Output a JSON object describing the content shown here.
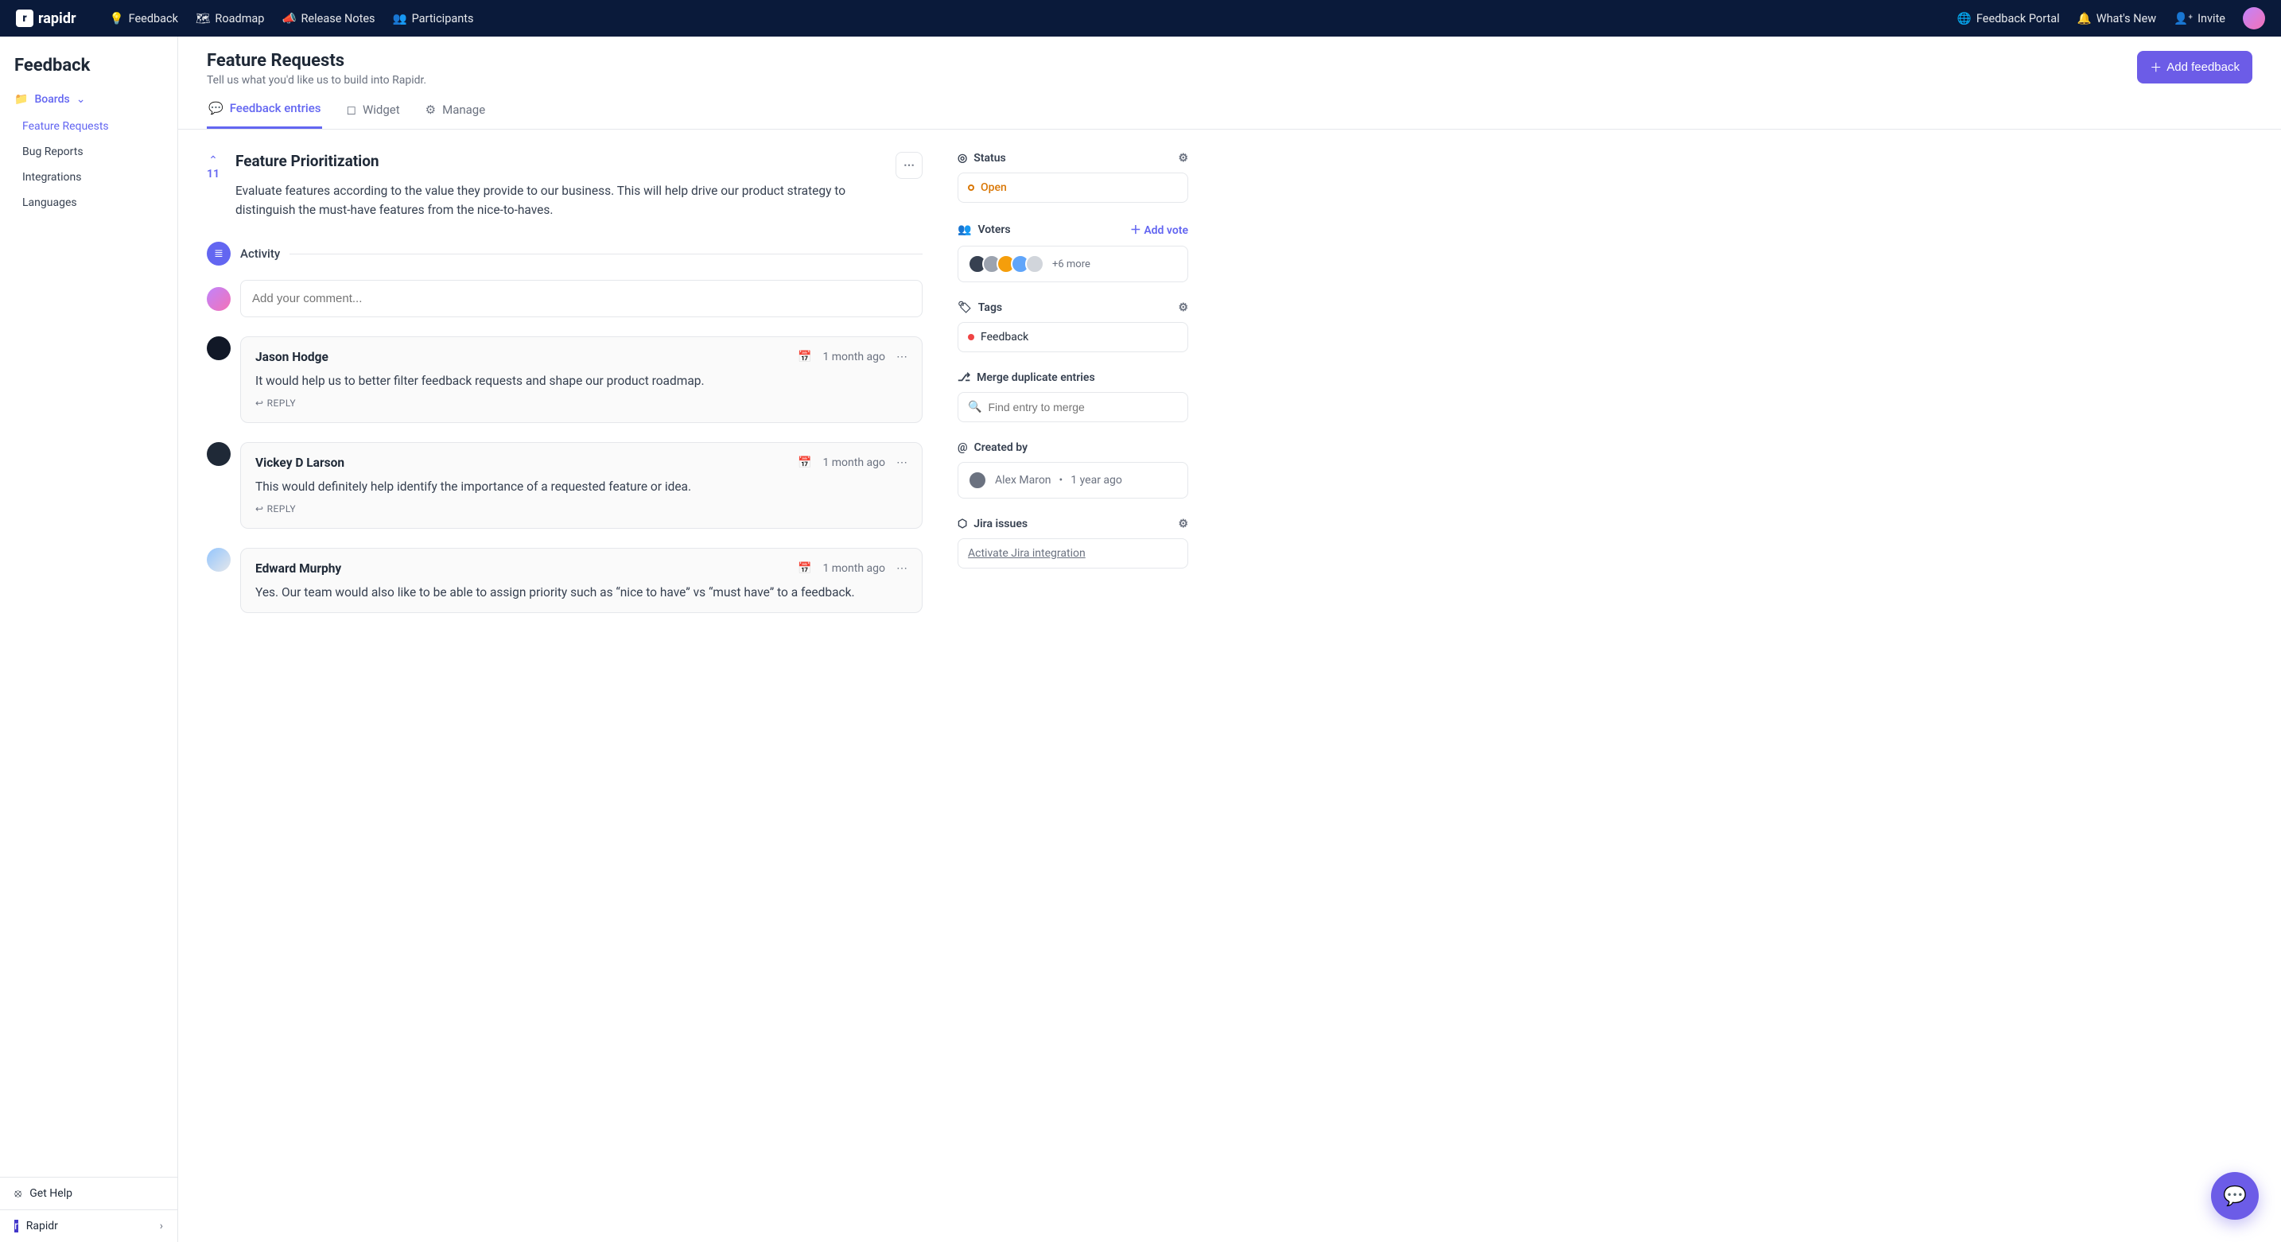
{
  "topnav": {
    "logo_text": "rapidr",
    "left": [
      {
        "label": "Feedback",
        "icon": "bulb"
      },
      {
        "label": "Roadmap",
        "icon": "map"
      },
      {
        "label": "Release Notes",
        "icon": "megaphone"
      },
      {
        "label": "Participants",
        "icon": "users"
      }
    ],
    "right": [
      {
        "label": "Feedback Portal",
        "icon": "globe"
      },
      {
        "label": "What's New",
        "icon": "bell"
      },
      {
        "label": "Invite",
        "icon": "user-plus"
      }
    ]
  },
  "sidebar": {
    "title": "Feedback",
    "boards_label": "Boards",
    "boards": [
      {
        "label": "Feature Requests",
        "active": true
      },
      {
        "label": "Bug Reports"
      },
      {
        "label": "Integrations"
      },
      {
        "label": "Languages"
      }
    ],
    "help_label": "Get Help",
    "org_label": "Rapidr"
  },
  "header": {
    "title": "Feature Requests",
    "subtitle": "Tell us what you'd like us to build into Rapidr.",
    "add_button": "Add feedback"
  },
  "tabs": [
    {
      "label": "Feedback entries",
      "icon": "chat",
      "active": true
    },
    {
      "label": "Widget",
      "icon": "box"
    },
    {
      "label": "Manage",
      "icon": "sliders"
    }
  ],
  "entry": {
    "votes": "11",
    "title": "Feature Prioritization",
    "description": "Evaluate features according to the value they provide to our business. This will help drive our product strategy to distinguish the must-have features from the nice-to-haves."
  },
  "activity": {
    "label": "Activity",
    "placeholder": "Add your comment...",
    "reply_label": "REPLY",
    "comments": [
      {
        "author": "Jason Hodge",
        "time": "1 month ago",
        "body": "It would help us to better filter feedback requests and shape our product roadmap."
      },
      {
        "author": "Vickey D Larson",
        "time": "1 month ago",
        "body": "This would definitely help identify the importance of a requested feature or idea."
      },
      {
        "author": "Edward Murphy",
        "time": "1 month ago",
        "body": "Yes. Our team would also like to be able to assign priority such as “nice to have” vs “must have” to a feedback."
      }
    ]
  },
  "side": {
    "status_label": "Status",
    "status_value": "Open",
    "voters_label": "Voters",
    "add_vote": "Add vote",
    "more_voters": "+6 more",
    "tags_label": "Tags",
    "tag_value": "Feedback",
    "merge_label": "Merge duplicate entries",
    "merge_placeholder": "Find entry to merge",
    "createdby_label": "Created by",
    "creator_name": "Alex Maron",
    "creator_time": "1 year ago",
    "jira_label": "Jira issues",
    "jira_link": "Activate Jira integration"
  }
}
